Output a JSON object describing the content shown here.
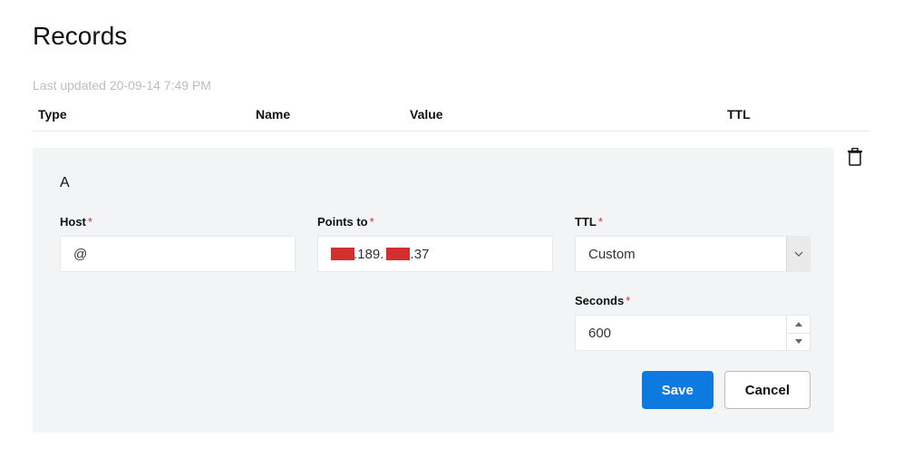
{
  "page": {
    "title": "Records",
    "last_updated": "Last updated 20-09-14 7:49 PM"
  },
  "table_header": {
    "type": "Type",
    "name": "Name",
    "value": "Value",
    "ttl": "TTL"
  },
  "record": {
    "type": "A",
    "host": {
      "label": "Host",
      "value": "@"
    },
    "points_to": {
      "label": "Points to",
      "display_value": "      .189.       .37"
    },
    "ttl": {
      "label": "TTL",
      "selected": "Custom"
    },
    "seconds": {
      "label": "Seconds",
      "value": "600"
    }
  },
  "buttons": {
    "save": "Save",
    "cancel": "Cancel"
  },
  "required_marker": "*"
}
